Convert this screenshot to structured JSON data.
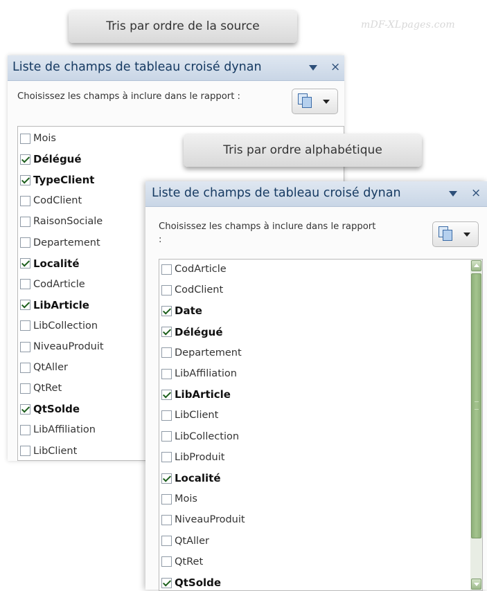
{
  "watermark": "mDF-XLpages.com",
  "callouts": {
    "source_order": "Tris par ordre de la source",
    "alpha_order": "Tris par ordre alphabétique"
  },
  "panel_source": {
    "title": "Liste de champs de tableau croisé dynan",
    "instruction": "Choisissez les champs à inclure dans le rapport :",
    "fields": [
      {
        "label": "Mois",
        "checked": false
      },
      {
        "label": "Délégué",
        "checked": true
      },
      {
        "label": "TypeClient",
        "checked": true
      },
      {
        "label": "CodClient",
        "checked": false
      },
      {
        "label": "RaisonSociale",
        "checked": false
      },
      {
        "label": "Departement",
        "checked": false
      },
      {
        "label": "Localité",
        "checked": true
      },
      {
        "label": "CodArticle",
        "checked": false
      },
      {
        "label": "LibArticle",
        "checked": true
      },
      {
        "label": "LibCollection",
        "checked": false
      },
      {
        "label": "NiveauProduit",
        "checked": false
      },
      {
        "label": "QtAller",
        "checked": false
      },
      {
        "label": "QtRet",
        "checked": false
      },
      {
        "label": "QtSolde",
        "checked": true
      },
      {
        "label": "LibAffiliation",
        "checked": false
      },
      {
        "label": "LibClient",
        "checked": false
      }
    ]
  },
  "panel_alpha": {
    "title": "Liste de champs de tableau croisé dynan",
    "instruction": "Choisissez les champs à inclure dans le rapport :",
    "fields": [
      {
        "label": "CodArticle",
        "checked": false
      },
      {
        "label": "CodClient",
        "checked": false
      },
      {
        "label": "Date",
        "checked": true
      },
      {
        "label": "Délégué",
        "checked": true
      },
      {
        "label": "Departement",
        "checked": false
      },
      {
        "label": "LibAffiliation",
        "checked": false
      },
      {
        "label": "LibArticle",
        "checked": true
      },
      {
        "label": "LibClient",
        "checked": false
      },
      {
        "label": "LibCollection",
        "checked": false
      },
      {
        "label": "LibProduit",
        "checked": false
      },
      {
        "label": "Localité",
        "checked": true
      },
      {
        "label": "Mois",
        "checked": false
      },
      {
        "label": "NiveauProduit",
        "checked": false
      },
      {
        "label": "QtAller",
        "checked": false
      },
      {
        "label": "QtRet",
        "checked": false
      },
      {
        "label": "QtSolde",
        "checked": true
      }
    ]
  },
  "icons": {
    "close": "×",
    "title_dropdown": "chevron-down-icon",
    "layout_button": "field-layout-icon"
  },
  "colors": {
    "title_text": "#163a62",
    "scrollbar_accent": "#8fb07a",
    "check_mark": "#1b5e1b"
  }
}
